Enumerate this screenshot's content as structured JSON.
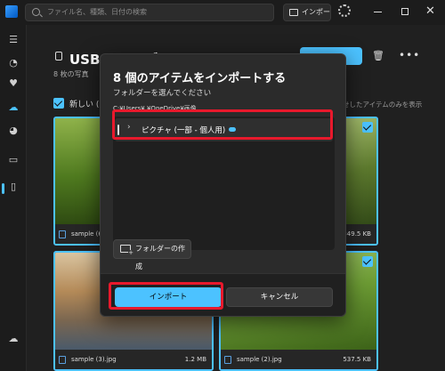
{
  "titlebar": {
    "search_placeholder": "ファイル名、種類、日付の検索",
    "import_label": "インポート"
  },
  "main": {
    "title": "USB ドライブ (E:)",
    "subtitle": "8 枚の写真",
    "new_label": "新しい (8)",
    "right_hint": "せしたアイテムのみを表示"
  },
  "tiles": [
    {
      "name": "sample (6).jpg",
      "size": ""
    },
    {
      "name": "",
      "size": "349.5 KB"
    },
    {
      "name": "sample (3).jpg",
      "size": "1.2 MB"
    },
    {
      "name": "sample (2).jpg",
      "size": "537.5 KB"
    }
  ],
  "dialog": {
    "title": "8 個のアイテムをインポートする",
    "subtitle": "フォルダーを選んでください",
    "path": "C:¥Users¥  ¥OneDrive¥画像",
    "tree_item": "ピクチャ (一部 - 個人用)",
    "new_folder_label": "フォルダーの作成",
    "import_button": "インポート",
    "cancel_button": "キャンセル"
  },
  "colors": {
    "accent": "#4cc2ff",
    "highlight": "#e8192c",
    "background": "#202020",
    "dialog_bg": "#2b2b2b"
  }
}
